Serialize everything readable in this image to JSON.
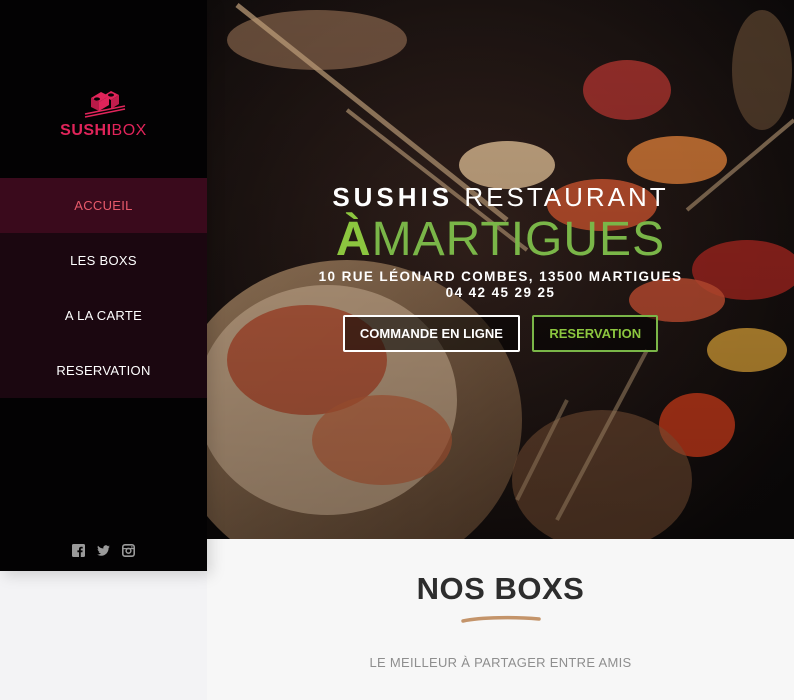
{
  "brand": {
    "name_part1": "SUSHI",
    "name_part2": "BOX",
    "color": "#e0245a"
  },
  "nav": {
    "items": [
      {
        "label": "ACCUEIL",
        "active": true
      },
      {
        "label": "LES BOXS",
        "active": false
      },
      {
        "label": "A LA CARTE",
        "active": false
      },
      {
        "label": "RESERVATION",
        "active": false
      }
    ]
  },
  "social": [
    "facebook-icon",
    "twitter-icon",
    "instagram-icon"
  ],
  "hero": {
    "title_bold": "SUSHIS",
    "title_light": "RESTAURANT",
    "city_accent": "À",
    "city": "MARTIGUES",
    "address": "10 RUE LÉONARD COMBES, 13500 MARTIGUES",
    "phone": "04 42 45 29 25",
    "order_button": "COMMANDE EN LIGNE",
    "reservation_button": "RESERVATION",
    "accent_color": "#7ab648"
  },
  "section": {
    "title": "NOS BOXS",
    "subtitle": "LE MEILLEUR À PARTAGER ENTRE AMIS"
  }
}
